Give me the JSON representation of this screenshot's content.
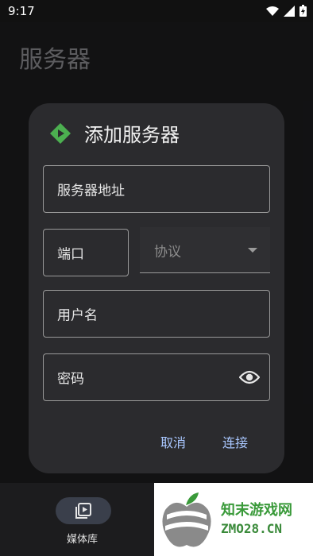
{
  "status_bar": {
    "time": "9:17"
  },
  "page": {
    "title": "服务器"
  },
  "dialog": {
    "title": "添加服务器",
    "fields": {
      "address_label": "服务器地址",
      "port_label": "端口",
      "protocol_label": "协议",
      "username_label": "用户名",
      "password_label": "密码"
    },
    "buttons": {
      "cancel": "取消",
      "connect": "连接"
    }
  },
  "bottom_nav": {
    "items": [
      {
        "label": "媒体库",
        "icon": "media-library-icon"
      }
    ]
  },
  "watermark": {
    "line1": "知末游戏网",
    "line2": "ZMO28.CN"
  },
  "colors": {
    "accent": "#a9c7ff",
    "brand_green": "#4caf50"
  }
}
